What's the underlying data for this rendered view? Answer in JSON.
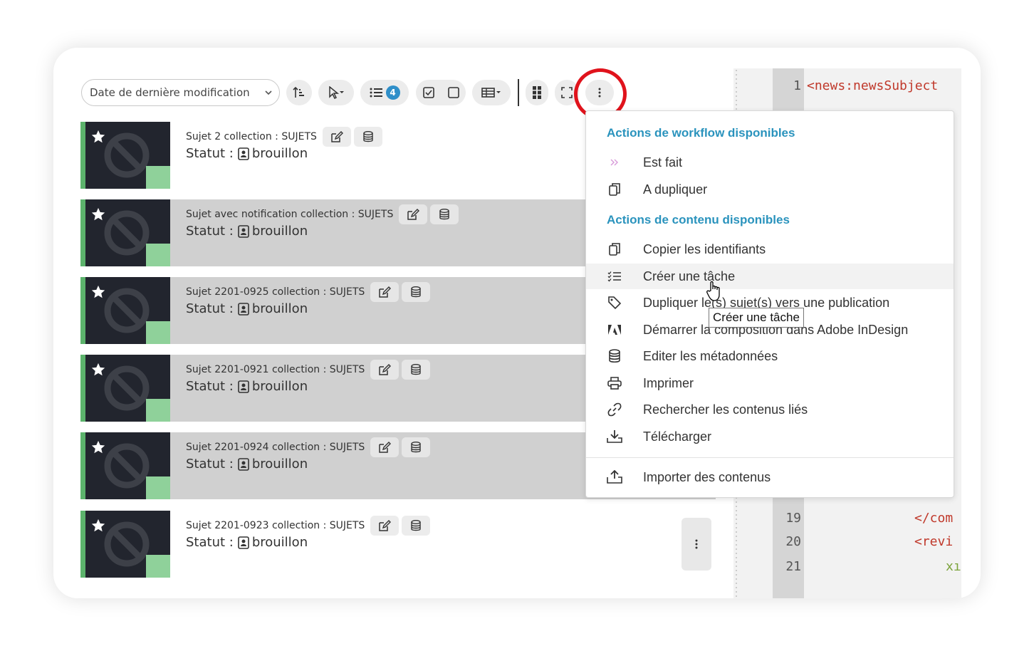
{
  "toolbar": {
    "sort_label": "Date de dernière modification",
    "selection_count": "4"
  },
  "items": [
    {
      "title": "Sujet 2 collection : SUJETS",
      "status_label": "Statut :",
      "status": "brouillon"
    },
    {
      "title": "Sujet avec notification collection : SUJETS",
      "status_label": "Statut :",
      "status": "brouillon"
    },
    {
      "title": "Sujet 2201-0925 collection : SUJETS",
      "status_label": "Statut :",
      "status": "brouillon"
    },
    {
      "title": "Sujet 2201-0921 collection : SUJETS",
      "status_label": "Statut :",
      "status": "brouillon"
    },
    {
      "title": "Sujet 2201-0924 collection : SUJETS",
      "status_label": "Statut :",
      "status": "brouillon"
    },
    {
      "title": "Sujet 2201-0923 collection : SUJETS",
      "status_label": "Statut :",
      "status": "brouillon"
    }
  ],
  "menu": {
    "workflow_heading": "Actions de workflow disponibles",
    "workflow_items": [
      {
        "label": "Est fait",
        "icon": "double-chevron-icon"
      },
      {
        "label": "A dupliquer",
        "icon": "copy-icon"
      }
    ],
    "content_heading": "Actions de contenu disponibles",
    "content_items": [
      {
        "label": "Copier les identifiants",
        "icon": "copy-icon"
      },
      {
        "label": "Créer une tâche",
        "icon": "task-list-icon"
      },
      {
        "label": "Dupliquer le(s) sujet(s) vers une publication",
        "icon": "tag-icon"
      },
      {
        "label": "Démarrer la composition dans Adobe InDesign",
        "icon": "adobe-icon"
      },
      {
        "label": "Editer les métadonnées",
        "icon": "database-icon"
      },
      {
        "label": "Imprimer",
        "icon": "printer-icon"
      },
      {
        "label": "Rechercher les contenus liés",
        "icon": "link-icon"
      },
      {
        "label": "Télécharger",
        "icon": "download-icon"
      }
    ],
    "footer_item": {
      "label": "Importer des contenus",
      "icon": "upload-icon"
    }
  },
  "tooltip": "Créer une tâche",
  "code": {
    "lines": [
      {
        "n": "1",
        "text": "<news:newsSubject"
      },
      {
        "n": "19",
        "text": "</com"
      },
      {
        "n": "20",
        "text": "<revi"
      },
      {
        "n": "21",
        "text": "xı"
      }
    ]
  },
  "colors": {
    "accent": "#2a93bd",
    "badge": "#2f8fc9",
    "highlight_circle": "#e0131c",
    "status_stripe": "#5cb36c"
  }
}
